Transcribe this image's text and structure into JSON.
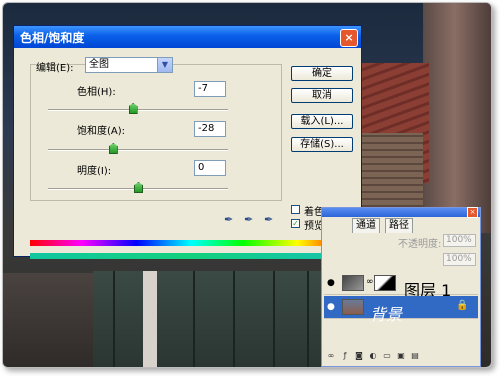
{
  "dialog": {
    "title": "色相/饱和度",
    "close_icon": "×",
    "edit_label": "编辑(E):",
    "edit_value": "全图",
    "hue_label": "色相(H):",
    "hue_value": "-7",
    "hue_level_pct": 47,
    "sat_label": "饱和度(A):",
    "sat_value": "-28",
    "sat_level_pct": 36,
    "light_label": "明度(I):",
    "light_value": "0",
    "light_level_pct": 50,
    "ok": "确定",
    "cancel": "取消",
    "load": "载入(L)...",
    "save": "存储(S)...",
    "colorize_label": "着色(O)",
    "colorize_checked": false,
    "preview_label": "预览(P)",
    "preview_checked": true
  },
  "layers_panel": {
    "tabs": [
      "通道",
      "路径"
    ],
    "opacity_label": "不透明度:",
    "opacity_value": "100%",
    "fill_value": "100%",
    "layers": [
      {
        "name": "图层 1",
        "selected": false
      },
      {
        "name": "背景",
        "selected": true
      }
    ]
  },
  "colors": {
    "title_blue": "#0a5fe8",
    "selection_blue": "#316ac5",
    "dialog_bg": "#ece9d8"
  }
}
